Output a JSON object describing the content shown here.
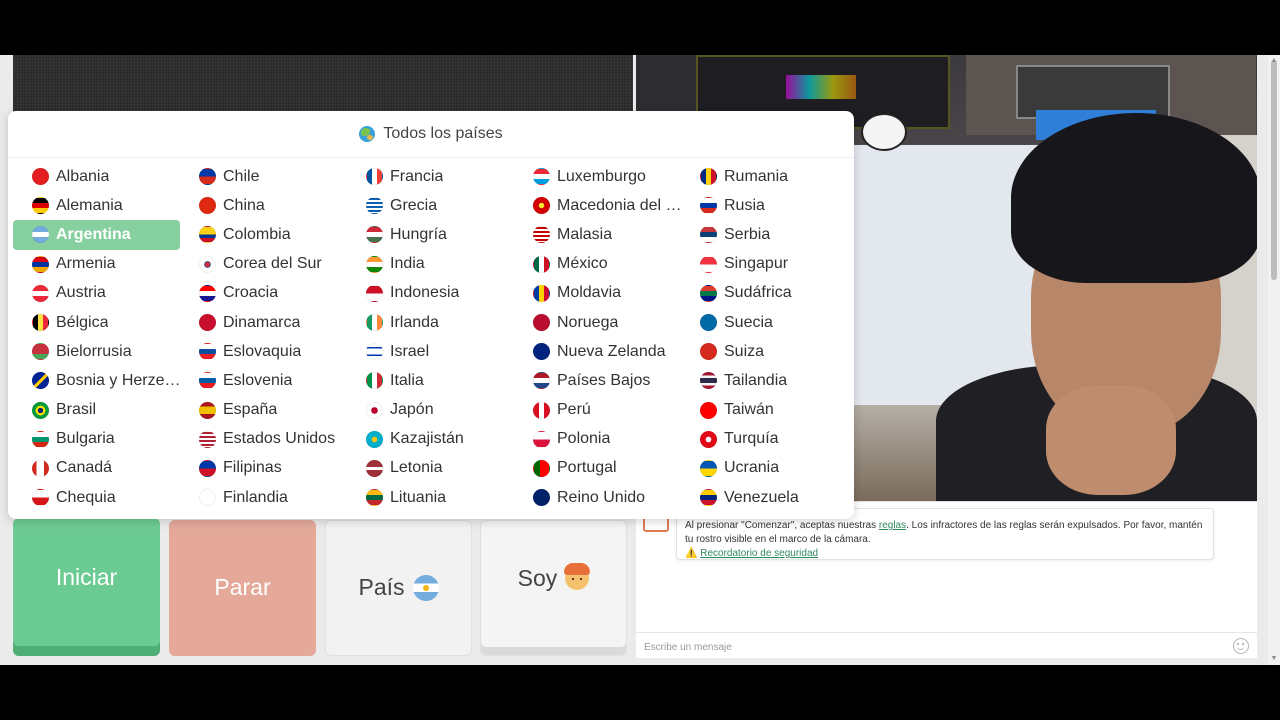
{
  "dropdown": {
    "title": "Todos los países",
    "columns": [
      [
        {
          "name": "Albania",
          "flag": "linear-gradient(#e41e20,#e41e20)"
        },
        {
          "name": "Alemania",
          "flag": "linear-gradient(180deg,#000 33%,#dd0000 33%,#dd0000 66%,#ffce00 66%)"
        },
        {
          "name": "Argentina",
          "flag": "linear-gradient(180deg,#74acdf 33%,#fff 33%,#fff 66%,#74acdf 66%)",
          "selected": true
        },
        {
          "name": "Armenia",
          "flag": "linear-gradient(180deg,#d90012 33%,#0033a0 33%,#0033a0 66%,#f2a800 66%)"
        },
        {
          "name": "Austria",
          "flag": "linear-gradient(180deg,#ed2939 33%,#fff 33%,#fff 66%,#ed2939 66%)"
        },
        {
          "name": "Bélgica",
          "flag": "linear-gradient(90deg,#000 33%,#fae042 33%,#fae042 66%,#ed2939 66%)"
        },
        {
          "name": "Bielorrusia",
          "flag": "linear-gradient(180deg,#c8313e 66%,#4aa657 66%)"
        },
        {
          "name": "Bosnia y Herzegovina",
          "flag": "linear-gradient(135deg,#002395 45%,#fecb00 45%,#fecb00 60%,#002395 60%)"
        },
        {
          "name": "Brasil",
          "flag": "radial-gradient(circle,#002776 25%,#fedf00 26%,#fedf00 45%,#009c3b 46%)"
        },
        {
          "name": "Bulgaria",
          "flag": "linear-gradient(180deg,#fff 33%,#00966e 33%,#00966e 66%,#d62612 66%)"
        },
        {
          "name": "Canadá",
          "flag": "linear-gradient(90deg,#d52b1e 25%,#fff 25%,#fff 75%,#d52b1e 75%)"
        },
        {
          "name": "Chequia",
          "flag": "linear-gradient(180deg,#fff 50%,#d7141a 50%)"
        }
      ],
      [
        {
          "name": "Chile",
          "flag": "linear-gradient(180deg,#0039a6 0,#0039a6 50%,#d52b1e 50%)"
        },
        {
          "name": "China",
          "flag": "linear-gradient(#de2910,#de2910)"
        },
        {
          "name": "Colombia",
          "flag": "linear-gradient(180deg,#fcd116 50%,#003893 50%,#003893 75%,#ce1126 75%)"
        },
        {
          "name": "Corea del Sur",
          "flag": "radial-gradient(circle,#cd2e3a 20%,#0047a0 30%,#fff 32%)"
        },
        {
          "name": "Croacia",
          "flag": "linear-gradient(180deg,#ff0000 33%,#fff 33%,#fff 66%,#171796 66%)"
        },
        {
          "name": "Dinamarca",
          "flag": "linear-gradient(#c8102e,#c8102e)"
        },
        {
          "name": "Eslovaquia",
          "flag": "linear-gradient(180deg,#fff 33%,#0b4ea2 33%,#0b4ea2 66%,#ee1c25 66%)"
        },
        {
          "name": "Eslovenia",
          "flag": "linear-gradient(180deg,#fff 33%,#005da4 33%,#005da4 66%,#ed1c24 66%)"
        },
        {
          "name": "España",
          "flag": "linear-gradient(180deg,#aa151b 25%,#f1bf00 25%,#f1bf00 75%,#aa151b 75%)"
        },
        {
          "name": "Estados Unidos",
          "flag": "repeating-linear-gradient(180deg,#b22234 0,#b22234 2px,#fff 2px,#fff 4px)"
        },
        {
          "name": "Filipinas",
          "flag": "linear-gradient(180deg,#0038a8 50%,#ce1126 50%)"
        },
        {
          "name": "Finlandia",
          "flag": "linear-gradient(#fff,#fff)"
        }
      ],
      [
        {
          "name": "Francia",
          "flag": "linear-gradient(90deg,#0055a4 33%,#fff 33%,#fff 66%,#ef4135 66%)"
        },
        {
          "name": "Grecia",
          "flag": "repeating-linear-gradient(180deg,#0d5eaf 0,#0d5eaf 2px,#fff 2px,#fff 4px)"
        },
        {
          "name": "Hungría",
          "flag": "linear-gradient(180deg,#ce2939 33%,#fff 33%,#fff 66%,#477050 66%)"
        },
        {
          "name": "India",
          "flag": "linear-gradient(180deg,#ff9933 33%,#fff 33%,#fff 66%,#138808 66%)"
        },
        {
          "name": "Indonesia",
          "flag": "linear-gradient(180deg,#ce1126 50%,#fff 50%)"
        },
        {
          "name": "Irlanda",
          "flag": "linear-gradient(90deg,#169b62 33%,#fff 33%,#fff 66%,#ff883e 66%)"
        },
        {
          "name": "Israel",
          "flag": "linear-gradient(180deg,#fff 20%,#0038b8 20%,#0038b8 30%,#fff 30%,#fff 70%,#0038b8 70%,#0038b8 80%,#fff 80%)"
        },
        {
          "name": "Italia",
          "flag": "linear-gradient(90deg,#009246 33%,#fff 33%,#fff 66%,#ce2b37 66%)"
        },
        {
          "name": "Japón",
          "flag": "radial-gradient(circle,#bc002d 30%,#fff 32%)"
        },
        {
          "name": "Kazajistán",
          "flag": "radial-gradient(circle,#fec50c 25%,#00afca 27%)"
        },
        {
          "name": "Letonia",
          "flag": "linear-gradient(180deg,#9e3039 40%,#fff 40%,#fff 60%,#9e3039 60%)"
        },
        {
          "name": "Lituania",
          "flag": "linear-gradient(180deg,#fdb913 33%,#006a44 33%,#006a44 66%,#c1272d 66%)"
        }
      ],
      [
        {
          "name": "Luxemburgo",
          "flag": "linear-gradient(180deg,#ed2939 33%,#fff 33%,#fff 66%,#00a1de 66%)"
        },
        {
          "name": "Macedonia del Norte",
          "flag": "radial-gradient(circle,#f8e92e 25%,#d20000 27%)"
        },
        {
          "name": "Malasia",
          "flag": "repeating-linear-gradient(180deg,#cc0001 0,#cc0001 2px,#fff 2px,#fff 4px)"
        },
        {
          "name": "México",
          "flag": "linear-gradient(90deg,#006847 33%,#fff 33%,#fff 66%,#ce1126 66%)"
        },
        {
          "name": "Moldavia",
          "flag": "linear-gradient(90deg,#003da5 33%,#ffd200 33%,#ffd200 66%,#cc092f 66%)"
        },
        {
          "name": "Noruega",
          "flag": "linear-gradient(#ba0c2f,#ba0c2f)"
        },
        {
          "name": "Nueva Zelanda",
          "flag": "linear-gradient(#00247d,#00247d)"
        },
        {
          "name": "Países Bajos",
          "flag": "linear-gradient(180deg,#ae1c28 33%,#fff 33%,#fff 66%,#21468b 66%)"
        },
        {
          "name": "Perú",
          "flag": "linear-gradient(90deg,#d91023 33%,#fff 33%,#fff 66%,#d91023 66%)"
        },
        {
          "name": "Polonia",
          "flag": "linear-gradient(180deg,#fff 50%,#dc143c 50%)"
        },
        {
          "name": "Portugal",
          "flag": "linear-gradient(90deg,#006600 40%,#ff0000 40%)"
        },
        {
          "name": "Reino Unido",
          "flag": "linear-gradient(#012169,#012169)"
        }
      ],
      [
        {
          "name": "Rumania",
          "flag": "linear-gradient(90deg,#002b7f 33%,#fcd116 33%,#fcd116 66%,#ce1126 66%)"
        },
        {
          "name": "Rusia",
          "flag": "linear-gradient(180deg,#fff 33%,#0039a6 33%,#0039a6 66%,#d52b1e 66%)"
        },
        {
          "name": "Serbia",
          "flag": "linear-gradient(180deg,#c6363c 33%,#0c4076 33%,#0c4076 66%,#fff 66%)"
        },
        {
          "name": "Singapur",
          "flag": "linear-gradient(180deg,#ef3340 50%,#fff 50%)"
        },
        {
          "name": "Sudáfrica",
          "flag": "linear-gradient(180deg,#e03c31 33%,#007749 33%,#007749 66%,#001489 66%)"
        },
        {
          "name": "Suecia",
          "flag": "linear-gradient(#006aa7,#006aa7)"
        },
        {
          "name": "Suiza",
          "flag": "linear-gradient(#d52b1e,#d52b1e)"
        },
        {
          "name": "Tailandia",
          "flag": "linear-gradient(180deg,#a51931 16%,#f4f5f8 16%,#f4f5f8 33%,#2d2a4a 33%,#2d2a4a 66%,#f4f5f8 66%,#f4f5f8 83%,#a51931 83%)"
        },
        {
          "name": "Taiwán",
          "flag": "linear-gradient(#fe0000,#fe0000)"
        },
        {
          "name": "Turquía",
          "flag": "radial-gradient(circle,#fff 25%,#e30a17 28%)"
        },
        {
          "name": "Ucrania",
          "flag": "linear-gradient(180deg,#0057b7 50%,#ffd700 50%)"
        },
        {
          "name": "Venezuela",
          "flag": "linear-gradient(180deg,#ffcc00 33%,#00247d 33%,#00247d 66%,#cf142b 66%)"
        }
      ]
    ]
  },
  "buttons": {
    "start": "Iniciar",
    "stop": "Parar",
    "country": "País",
    "gender": "Soy"
  },
  "chat": {
    "rules_pre": "Al presionar \"Comenzar\", aceptas nuestras ",
    "rules_link": "reglas",
    "rules_post": ". Los infractores de las reglas serán expulsados. Por favor, mantén tu rostro visible en el marco de la cámara.",
    "safety_link": "Recordatorio de seguridad",
    "input_placeholder": "Escribe un mensaje"
  }
}
